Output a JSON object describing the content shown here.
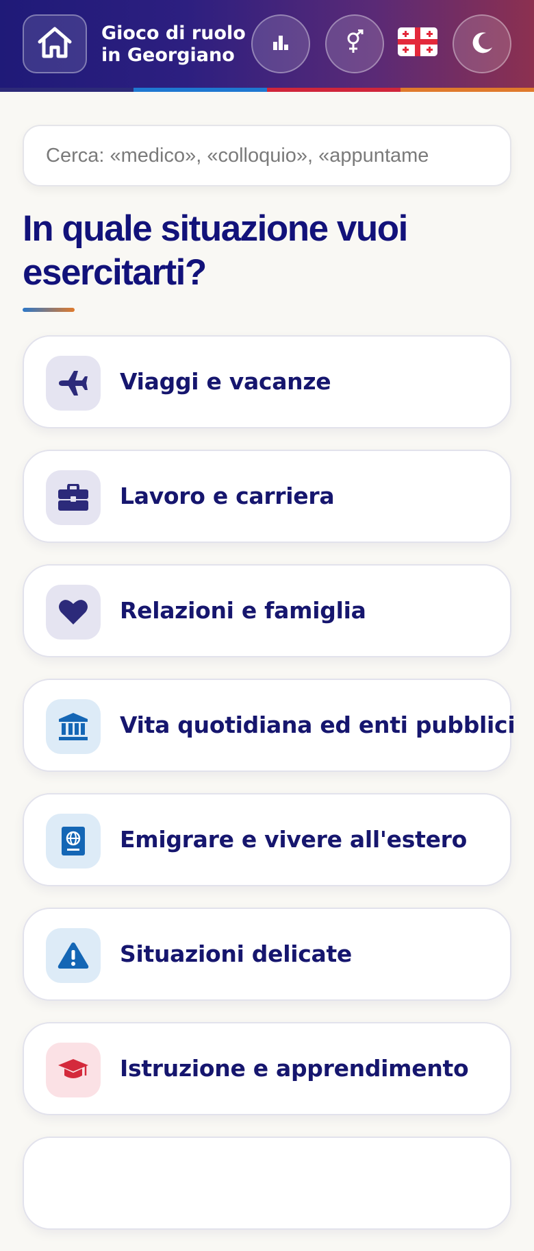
{
  "header": {
    "title": "Gioco di ruolo in Georgiano",
    "home_icon": "home-icon",
    "stats_icon": "bar-chart-icon",
    "gender_icon": "gender-icon",
    "flag_icon": "georgia-flag-icon",
    "theme_icon": "moon-icon",
    "stripe_colors": [
      "#2d2a78",
      "#1f78d1",
      "#d0263b",
      "#e07a2c"
    ]
  },
  "search": {
    "placeholder": "Cerca: «medico», «colloquio», «appuntame"
  },
  "main": {
    "heading": "In quale situazione vuoi esercitarti?",
    "categories": [
      {
        "label": "Viaggi e vacanze",
        "icon": "airplane-icon",
        "icon_color": "#2c2a7a",
        "icon_bg": "#e5e4f1"
      },
      {
        "label": "Lavoro e carriera",
        "icon": "briefcase-icon",
        "icon_color": "#2c2a7a",
        "icon_bg": "#e5e4f1"
      },
      {
        "label": "Relazioni e famiglia",
        "icon": "heart-icon",
        "icon_color": "#2c2a7a",
        "icon_bg": "#e5e4f1"
      },
      {
        "label": "Vita quotidiana ed enti pubblici",
        "icon": "bank-icon",
        "icon_color": "#1466b5",
        "icon_bg": "#ddebf7"
      },
      {
        "label": "Emigrare e vivere all'estero",
        "icon": "passport-icon",
        "icon_color": "#1466b5",
        "icon_bg": "#ddebf7"
      },
      {
        "label": "Situazioni delicate",
        "icon": "warning-icon",
        "icon_color": "#1466b5",
        "icon_bg": "#ddebf7"
      },
      {
        "label": "Istruzione e apprendimento",
        "icon": "graduation-cap-icon",
        "icon_color": "#d42a3c",
        "icon_bg": "#fbe1e5"
      }
    ]
  }
}
